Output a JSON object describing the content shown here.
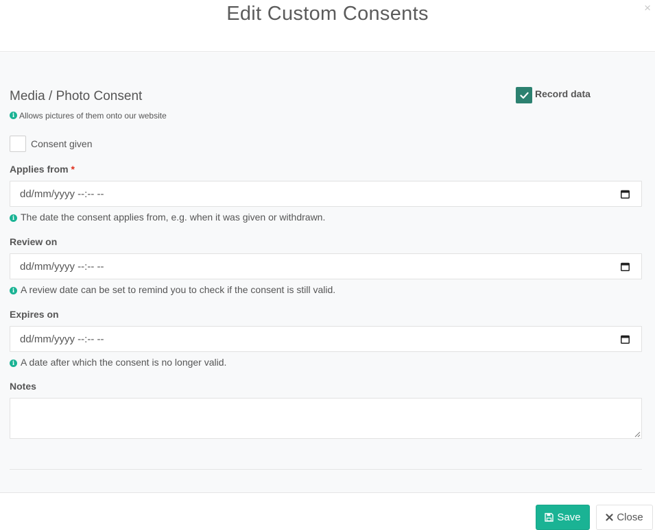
{
  "modal": {
    "title": "Edit Custom Consents",
    "close_glyph": "×"
  },
  "consent": {
    "title": "Media / Photo Consent",
    "description": "Allows pictures of them onto our website",
    "record_data_label": "Record data",
    "record_data_checked": true,
    "consent_given_label": "Consent given",
    "consent_given_checked": false
  },
  "fields": {
    "applies_from": {
      "label": "Applies from",
      "required_marker": "*",
      "value": "dd/mm/yyyy --:-- --",
      "help": "The date the consent applies from, e.g. when it was given or withdrawn."
    },
    "review_on": {
      "label": "Review on",
      "value": "dd/mm/yyyy --:-- --",
      "help": "A review date can be set to remind you to check if the consent is still valid."
    },
    "expires_on": {
      "label": "Expires on",
      "value": "dd/mm/yyyy --:-- --",
      "help": "A date after which the consent is no longer valid."
    },
    "notes": {
      "label": "Notes",
      "value": ""
    }
  },
  "footer": {
    "save_label": "Save",
    "close_label": "Close"
  },
  "icons": {
    "info": "info-circle-icon",
    "calendar": "calendar-icon",
    "save": "floppy-disk-icon",
    "close": "times-icon",
    "check": "check-icon"
  },
  "colors": {
    "accent": "#1ab394",
    "checkbox_checked": "#2c8170",
    "required": "#e0301e",
    "body_background": "#f8f9fa"
  }
}
